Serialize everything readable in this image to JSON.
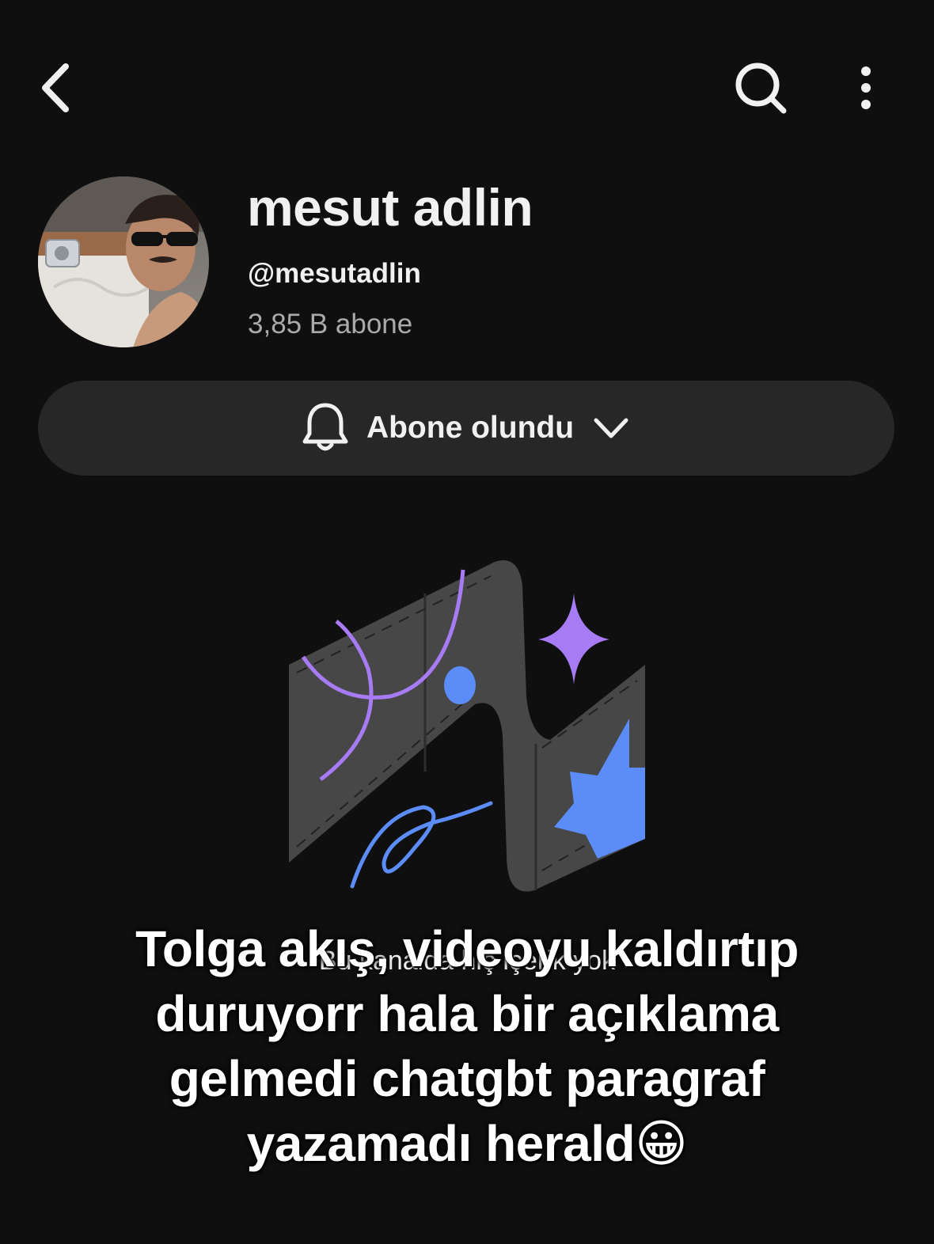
{
  "topbar": {
    "back_icon": "chevron-left-icon",
    "search_icon": "search-icon",
    "more_icon": "more-vertical-icon"
  },
  "channel": {
    "name": "mesut adlin",
    "handle": "@mesutadlin",
    "subscribers": "3,85 B abone"
  },
  "subscribe_button": {
    "label": "Abone olundu",
    "bell_icon": "bell-icon",
    "chevron_icon": "chevron-down-icon"
  },
  "empty_state": {
    "message": "Bu kanalda hiç içerik yok"
  },
  "overlay_caption": "Tolga akış, videoyu kaldırtıp duruyorr hala bir açıklama gelmedi chatgbt paragraf yazamadı herald😀",
  "colors": {
    "background": "#0f0f0f",
    "button_bg": "#272727",
    "text_primary": "#f1f1f1",
    "text_secondary": "#aaaaaa",
    "accent_purple": "#a77bf3",
    "accent_blue": "#5b8cf7"
  }
}
